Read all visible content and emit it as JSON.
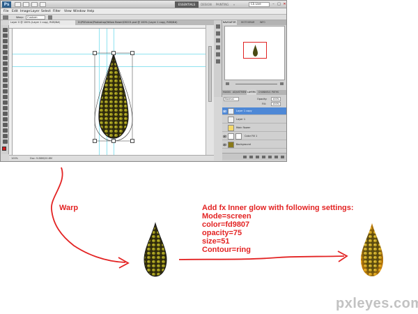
{
  "app": {
    "logo": "Ps",
    "workspaces": [
      "ESSENTIALS",
      "DESIGN",
      "PAINTING"
    ],
    "search_label": "CS Live",
    "window_controls": [
      "–",
      "□",
      "✕"
    ]
  },
  "menu": [
    "File",
    "Edit",
    "Image",
    "Layer",
    "Select",
    "Filter",
    "View",
    "Window",
    "Help"
  ],
  "options_bar": {
    "warp_label": "Warp:",
    "warp_value": "Custom"
  },
  "document_tabs": [
    {
      "label": "Layer 0 @ 100% (Layer 1 copy, RGB/8#)",
      "active": true
    },
    {
      "label": "D:\\PSExtras\\Photoshop\\Yellow flower\\DSC01.psd @ 100% (Layer 1 copy, RGB/8#)",
      "active": false
    }
  ],
  "status_bar": {
    "zoom": "100%",
    "doc_size": "Doc: 9.88M/20.8M"
  },
  "panels": {
    "top_tabs": [
      "NAVIGATOR",
      "HISTOGRAM",
      "INFO"
    ],
    "layer_tabs": [
      "MASKS",
      "ADJUSTMENTS",
      "LAYERS",
      "CHANNELS",
      "PATHS"
    ],
    "blend_mode": "Normal",
    "opacity_label": "Opacity:",
    "opacity_value": "100%",
    "fill_label": "Fill:",
    "fill_value": "100%",
    "layers": [
      {
        "name": "Layer 1 copy",
        "selected": true
      },
      {
        "name": "Layer 1",
        "selected": false
      },
      {
        "name": "Main flower",
        "selected": false
      },
      {
        "name": "Color Fill 1",
        "selected": false
      },
      {
        "name": "Background",
        "selected": false
      }
    ]
  },
  "annotations": {
    "warp": "Warp",
    "instructions": [
      "Add fx Inner glow with following settings:",
      "Mode=screen",
      "color=fd9807",
      "opacity=75",
      "size=51",
      "Contour=ring"
    ]
  },
  "watermark": "pxleyes.com",
  "colors": {
    "accent_red": "#e32323",
    "selected_layer": "#4e88d6",
    "guide": "#8fe3f0",
    "glow": "#fd9807"
  }
}
